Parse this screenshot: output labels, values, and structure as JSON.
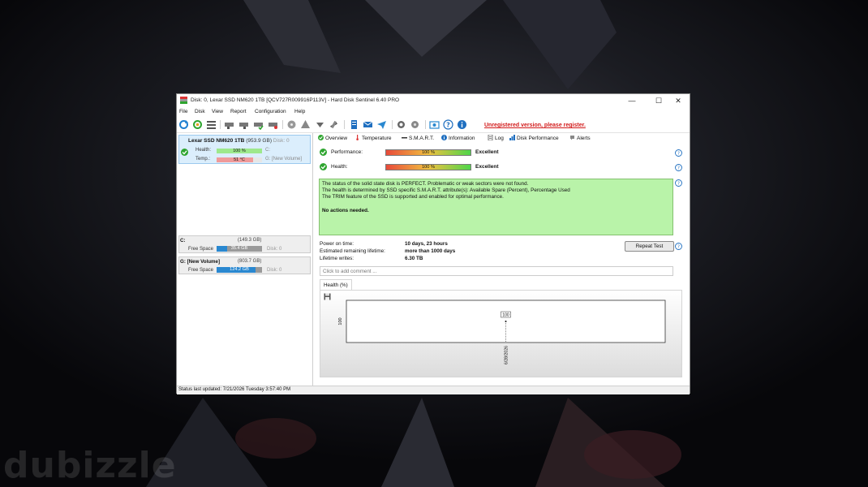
{
  "window": {
    "title": "Disk: 0, Lexar SSD NM620 1TB [QCV727R009916P113V]  -  Hard Disk Sentinel 6.40 PRO"
  },
  "menu": [
    "File",
    "Disk",
    "View",
    "Report",
    "Configuration",
    "Help"
  ],
  "toolbar": {
    "icons": [
      "refresh-icon",
      "refresh-all-icon",
      "disk-list-icon",
      "hdd-icon",
      "hdd-test-icon",
      "hdd-check-icon",
      "hdd-error-icon",
      "hdd-remove-icon",
      "disk-info-icon",
      "warning-triangle-icon",
      "eject-icon",
      "tools-icon",
      "report-icon",
      "mail-icon",
      "send-icon",
      "settings-gear-icon",
      "configuration-icon",
      "screenshot-icon",
      "help-question-icon",
      "info-icon"
    ],
    "unregistered_text": "Unregistered version, please register."
  },
  "colors": {
    "accent": "#2a88d0",
    "ok_green": "#2fa530",
    "status_box": "#b9f3a9",
    "warning_red": "#d21a1a"
  },
  "disk": {
    "name": "Lexar SSD NM620 1TB",
    "size": "(953.9 GB)",
    "index": "Disk: 0",
    "health_label": "Health:",
    "health_value": "100 %",
    "health_fraction": 1.0,
    "health_drive": "C:",
    "temp_label": "Temp.:",
    "temp_value": "51 °C",
    "temp_fraction": 0.8,
    "temp_drive": "G: [New Volume]"
  },
  "volumes": [
    {
      "name": "C:",
      "size": "(149.3 GB)",
      "free_label": "Free Space",
      "free_value": "35.4 GB",
      "free_fraction": 0.24,
      "disk": "Disk: 0"
    },
    {
      "name": "G: [New Volume]",
      "size": "(803.7 GB)",
      "free_label": "Free Space",
      "free_value": "124.2 GB",
      "free_fraction": 0.85,
      "disk": "Disk: 0"
    }
  ],
  "tabs": [
    {
      "label": "Overview",
      "icon": "check-circle-icon"
    },
    {
      "label": "Temperature",
      "icon": "thermometer-icon"
    },
    {
      "label": "S.M.A.R.T.",
      "icon": "smart-bar-icon"
    },
    {
      "label": "Information",
      "icon": "info-icon"
    },
    {
      "label": "Log",
      "icon": "log-document-icon"
    },
    {
      "label": "Disk Performance",
      "icon": "performance-icon"
    },
    {
      "label": "Alerts",
      "icon": "alert-icon"
    }
  ],
  "overview": {
    "performance": {
      "label": "Performance:",
      "value": "100 %",
      "fraction": 1.0,
      "rating": "Excellent"
    },
    "health": {
      "label": "Health:",
      "value": "100 %",
      "fraction": 1.0,
      "rating": "Excellent"
    },
    "status_lines": [
      "The status of the solid state disk is PERFECT. Problematic or weak sectors were not found.",
      "The health is determined by SSD specific S.M.A.R.T. attribute(s):  Available Spare (Percent), Percentage Used",
      "The TRIM feature of the SSD is supported and enabled for optimal performance."
    ],
    "actions": "No actions needed.",
    "stats": [
      {
        "label": "Power on time:",
        "value": "10 days, 23 hours"
      },
      {
        "label": "Estimated remaining lifetime:",
        "value": "more than 1000 days"
      },
      {
        "label": "Lifetime writes:",
        "value": "6.30 TB"
      }
    ],
    "repeat_button": "Repeat Test",
    "comment_placeholder": "Click to add comment ..."
  },
  "health_chart_tab": "Health (%)",
  "chart_data": {
    "type": "line",
    "x": [
      "6/28/2026"
    ],
    "values": [
      100
    ],
    "data_labels": [
      "100"
    ],
    "ytick_labels": [
      "100"
    ],
    "ylim": [
      100,
      100
    ]
  },
  "statusbar": {
    "text": "Status last updated: 7/21/2026 Tuesday 3:57:40 PM"
  },
  "watermark": "dubizzle"
}
